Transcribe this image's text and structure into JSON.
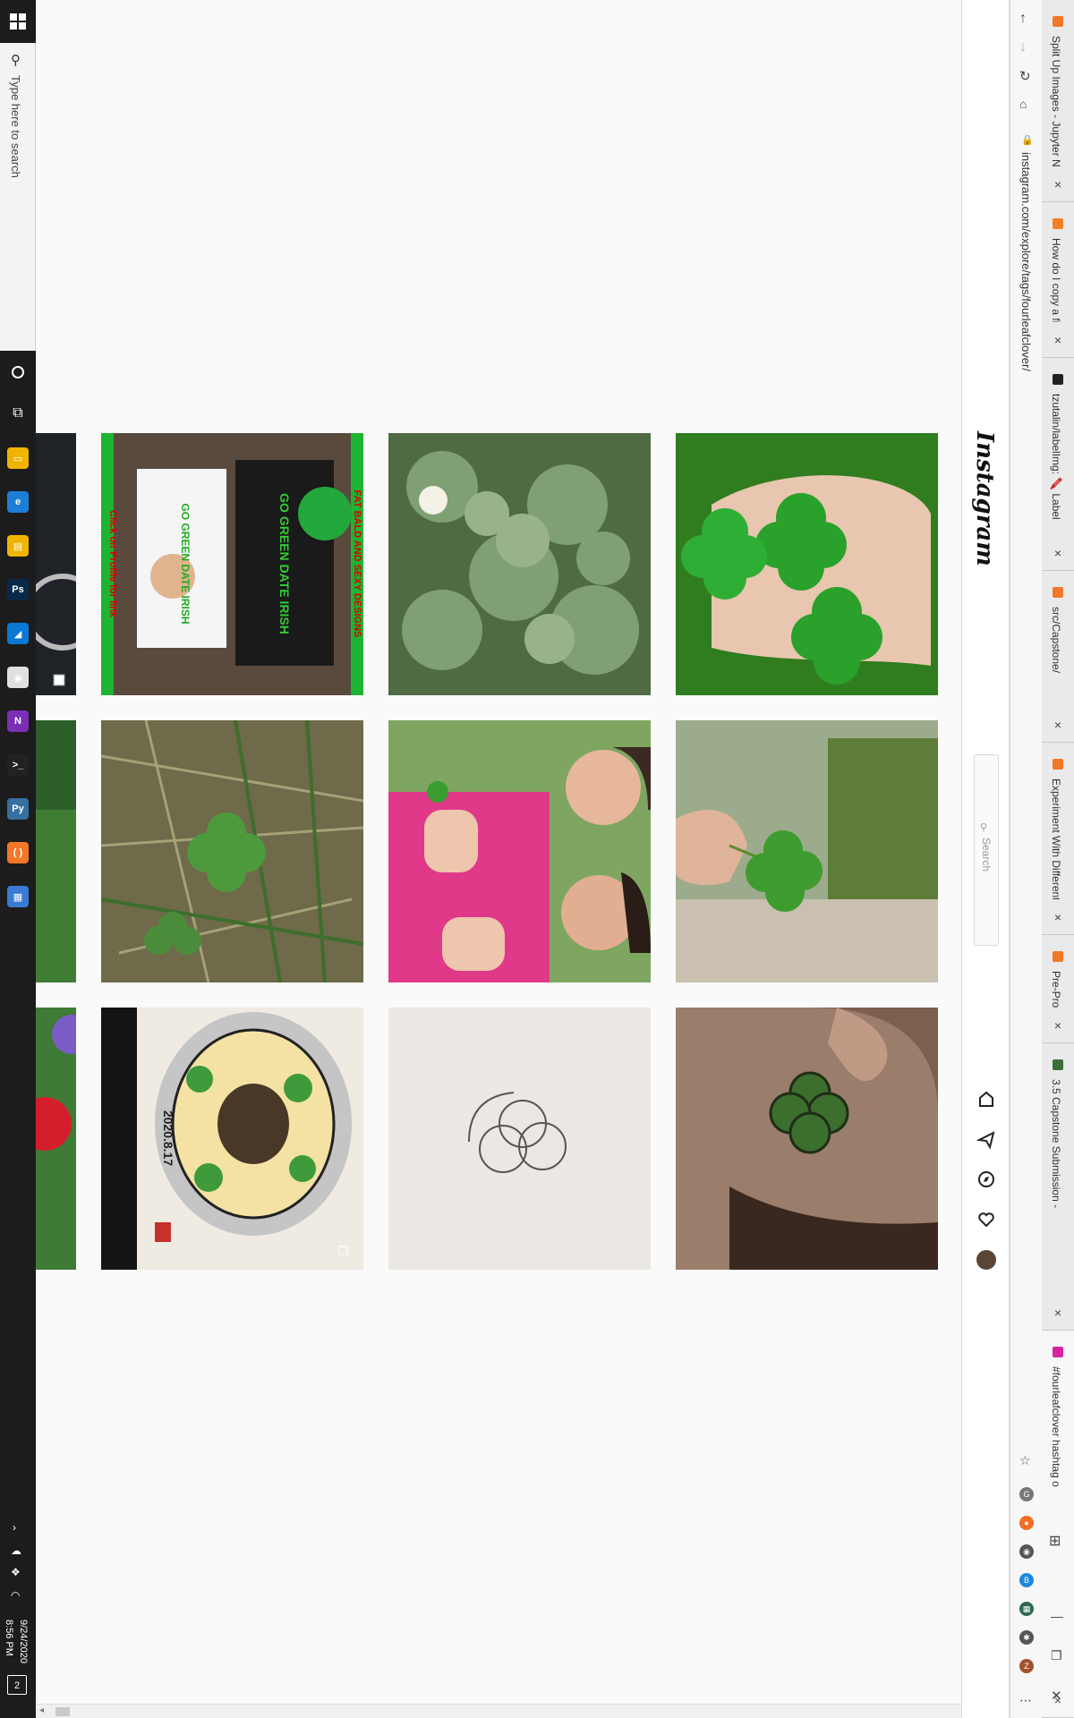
{
  "taskbar": {
    "search_placeholder": "Type here to search",
    "clock_time": "8:56 PM",
    "clock_date": "9/24/2020",
    "notifications_count": "2",
    "apps": [
      {
        "name": "file-explorer",
        "color": "#f0b400",
        "glyph": "▭"
      },
      {
        "name": "edge",
        "color": "#1e7ed6",
        "glyph": "e"
      },
      {
        "name": "files",
        "color": "#f0b400",
        "glyph": "▤"
      },
      {
        "name": "photoshop",
        "color": "#0a2a4a",
        "glyph": "Ps"
      },
      {
        "name": "azure",
        "color": "#0a78d4",
        "glyph": "◢"
      },
      {
        "name": "chrome",
        "color": "#e0e0e0",
        "glyph": "◉"
      },
      {
        "name": "onenote",
        "color": "#7a2fb6",
        "glyph": "N"
      },
      {
        "name": "terminal",
        "color": "#222",
        "glyph": ">_"
      },
      {
        "name": "python",
        "color": "#3670a0",
        "glyph": "Py"
      },
      {
        "name": "jupyter",
        "color": "#f37726",
        "glyph": "( )"
      },
      {
        "name": "calculator",
        "color": "#3a7bd5",
        "glyph": "▦"
      }
    ]
  },
  "browser": {
    "tabs": [
      {
        "label": "Split Up Images - Jupyter N",
        "icon_color": "#f37726"
      },
      {
        "label": "How do I copy a file in Pyth",
        "icon_color": "#f48024"
      },
      {
        "label": "tzutalin/labelImg: 🖍️ Label",
        "icon_color": "#222"
      },
      {
        "label": "src/Capstone/",
        "icon_color": "#f37726"
      },
      {
        "label": "Experiment With Different",
        "icon_color": "#f37726"
      },
      {
        "label": "Pre-Process Files - Jupyter",
        "icon_color": "#f37726"
      },
      {
        "label": "3.5 Capstone Submission -",
        "icon_color": "#3b6e3b"
      },
      {
        "label": "#fourleafclover hashtag o",
        "icon_color": "#d6249f"
      }
    ],
    "url": "instagram.com/explore/tags/fourleafclover/",
    "extension_colors": [
      "#777",
      "#f36c21",
      "#555",
      "#1c8adb",
      "#2d6a4f",
      "#555",
      "#a0522d"
    ],
    "extension_labels": [
      "G",
      "●",
      "◉",
      "B",
      "▦",
      "✱",
      "Z"
    ]
  },
  "instagram": {
    "logo": "Instagram",
    "search_placeholder": "Search",
    "nav_icons": [
      "home-icon",
      "direct-icon",
      "explore-icon",
      "activity-icon",
      "profile-avatar"
    ]
  },
  "posts": {
    "row1": [
      {
        "name": "hand-four-leaf-clovers-post",
        "bg": "#2f7d1e"
      },
      {
        "name": "clover-patch-post",
        "bg": "#6a8a5a"
      },
      {
        "name": "go-green-shirts-post",
        "bg": "#1db431",
        "lines": [
          "FAT BALD AND SEXY DESIGNS",
          "GO GREEN DATE IRISH",
          "GO GREEN DATE IRISH",
          "Click on Profile for link"
        ]
      }
    ],
    "row2": [
      {
        "name": "clover-held-garden-post",
        "bg": "#8ea07c"
      },
      {
        "name": "two-people-clover-post",
        "bg": "#d9307a"
      },
      {
        "name": "clover-in-grass-post",
        "bg": "#7b7556"
      }
    ],
    "row3": [
      {
        "name": "clover-ear-tattoo-post",
        "bg": "#9a7b68"
      },
      {
        "name": "clover-line-drawing-post",
        "bg": "#ebe7e2"
      },
      {
        "name": "painted-bowl-post",
        "bg": "#ece8df",
        "caption": "2020.8.17"
      }
    ]
  }
}
